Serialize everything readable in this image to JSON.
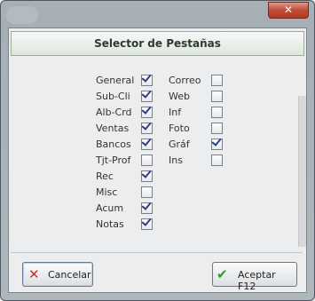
{
  "window": {
    "close_glyph": "✕"
  },
  "dialog": {
    "title": "Selector de Pestañas"
  },
  "tabs_left": [
    {
      "label": "General",
      "checked": true
    },
    {
      "label": "Sub-Cli",
      "checked": true
    },
    {
      "label": "Alb-Crd",
      "checked": true
    },
    {
      "label": "Ventas",
      "checked": true
    },
    {
      "label": "Bancos",
      "checked": true
    },
    {
      "label": "Tjt-Prof",
      "checked": false
    },
    {
      "label": "Rec",
      "checked": true
    },
    {
      "label": "Misc",
      "checked": false
    },
    {
      "label": "Acum",
      "checked": true
    },
    {
      "label": "Notas",
      "checked": true
    }
  ],
  "tabs_right": [
    {
      "label": "Correo",
      "checked": false
    },
    {
      "label": "Web",
      "checked": false
    },
    {
      "label": "Inf",
      "checked": false
    },
    {
      "label": "Foto",
      "checked": false
    },
    {
      "label": "Gráf",
      "checked": true
    },
    {
      "label": "Ins",
      "checked": false
    }
  ],
  "buttons": {
    "cancel_label": "Cancelar",
    "accept_label": "Aceptar F12",
    "cancel_icon": "red-x-icon",
    "accept_icon": "green-check-icon"
  }
}
